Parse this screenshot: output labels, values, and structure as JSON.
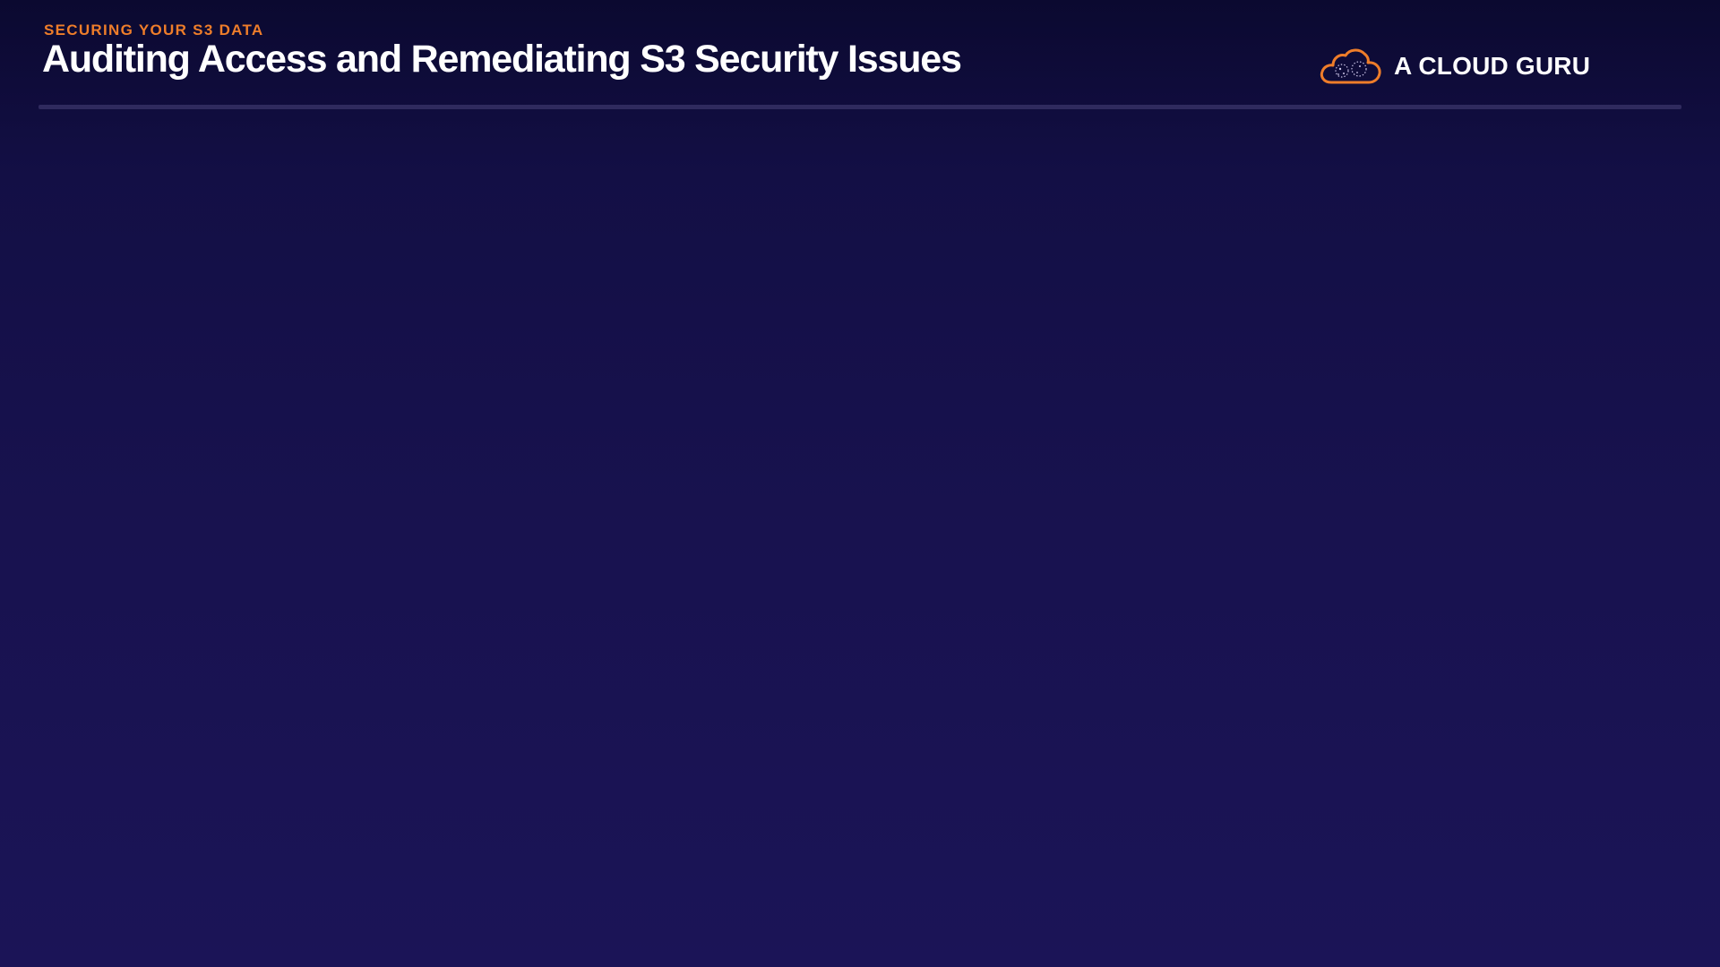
{
  "header": {
    "eyebrow": "SECURING YOUR S3 DATA",
    "title": "Auditing Access and Remediating S3 Security Issues"
  },
  "brand": {
    "name": "A CLOUD GURU",
    "logo_icon": "cloud-logo-icon",
    "accent_color": "#ee7d2a"
  },
  "colors": {
    "background_top": "#0b0930",
    "background_bottom": "#1b1457",
    "divider": "#2f2a5e",
    "text": "#ffffff"
  }
}
